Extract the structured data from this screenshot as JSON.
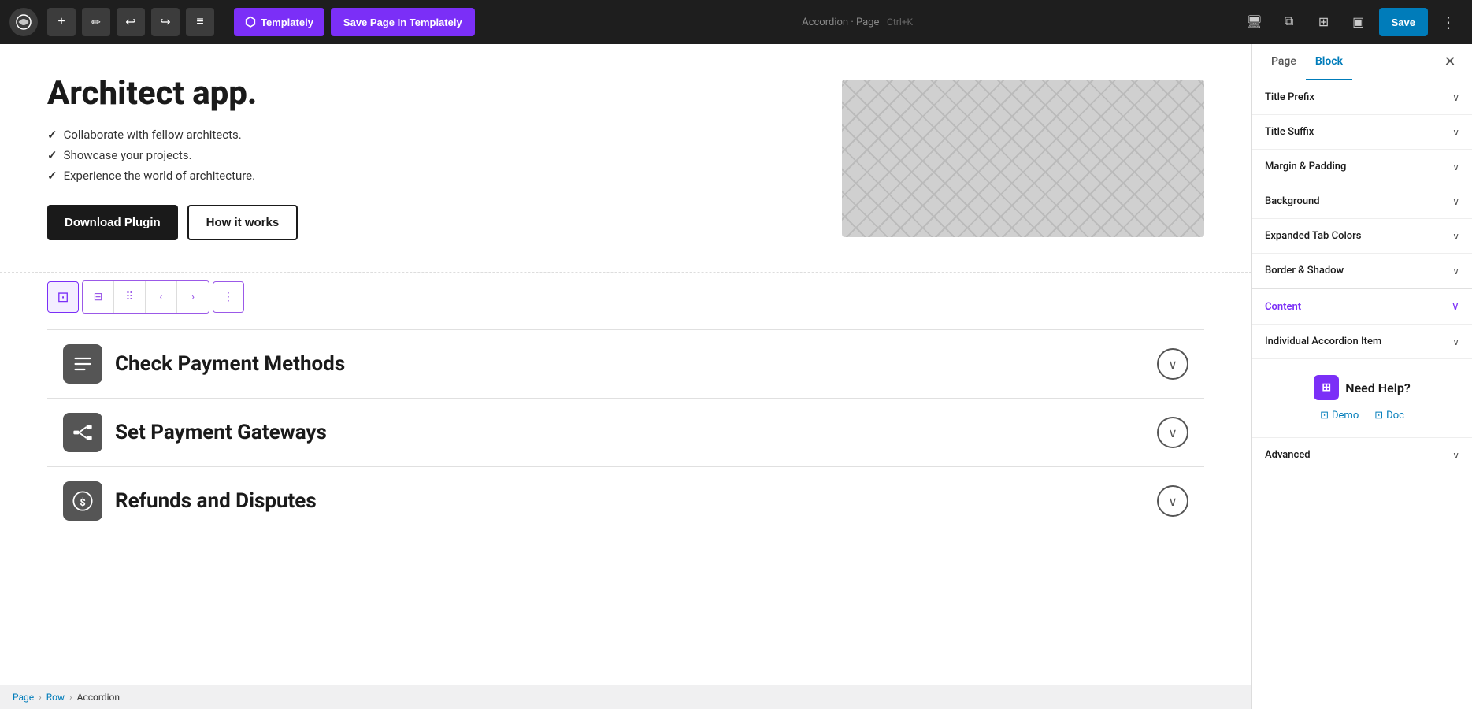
{
  "topbar": {
    "wp_logo": "W",
    "add_btn": "+",
    "edit_btn": "✏",
    "undo_btn": "↩",
    "redo_btn": "↪",
    "list_btn": "≡",
    "templately_btn": "Templately",
    "save_templately_btn": "Save Page In Templately",
    "page_title": "Accordion · Page",
    "shortcut": "Ctrl+K",
    "save_btn": "Save"
  },
  "sidebar_tabs": {
    "page_tab": "Page",
    "block_tab": "Block"
  },
  "sidebar_sections": [
    {
      "label": "Title Prefix"
    },
    {
      "label": "Title Suffix"
    },
    {
      "label": "Margin & Padding"
    },
    {
      "label": "Background"
    },
    {
      "label": "Expanded Tab Colors"
    },
    {
      "label": "Border & Shadow"
    }
  ],
  "content": {
    "label": "Content",
    "chevron": "∨"
  },
  "individual_accordion": {
    "label": "Individual Accordion Item",
    "chevron": "∨"
  },
  "need_help": {
    "title": "Need Help?",
    "demo_label": "Demo",
    "doc_label": "Doc"
  },
  "advanced": {
    "label": "Advanced",
    "chevron": "∨"
  },
  "hero": {
    "title": "Architect app.",
    "list": [
      "Collaborate with fellow architects.",
      "Showcase your projects.",
      "Experience the world of architecture."
    ],
    "btn_primary": "Download Plugin",
    "btn_secondary": "How it works"
  },
  "accordion_items": [
    {
      "title": "Check Payment Methods",
      "icon_type": "list"
    },
    {
      "title": "Set Payment Gateways",
      "icon_type": "flow"
    },
    {
      "title": "Refunds and Disputes",
      "icon_type": "dollar"
    }
  ],
  "breadcrumb": {
    "page": "Page",
    "row": "Row",
    "accordion": "Accordion"
  },
  "toolbar": {
    "align_icon": "⊡",
    "layout_icon": "⊟",
    "drag_icon": "⠿",
    "prev_icon": "‹",
    "next_icon": "›",
    "more_icon": "⋮"
  }
}
